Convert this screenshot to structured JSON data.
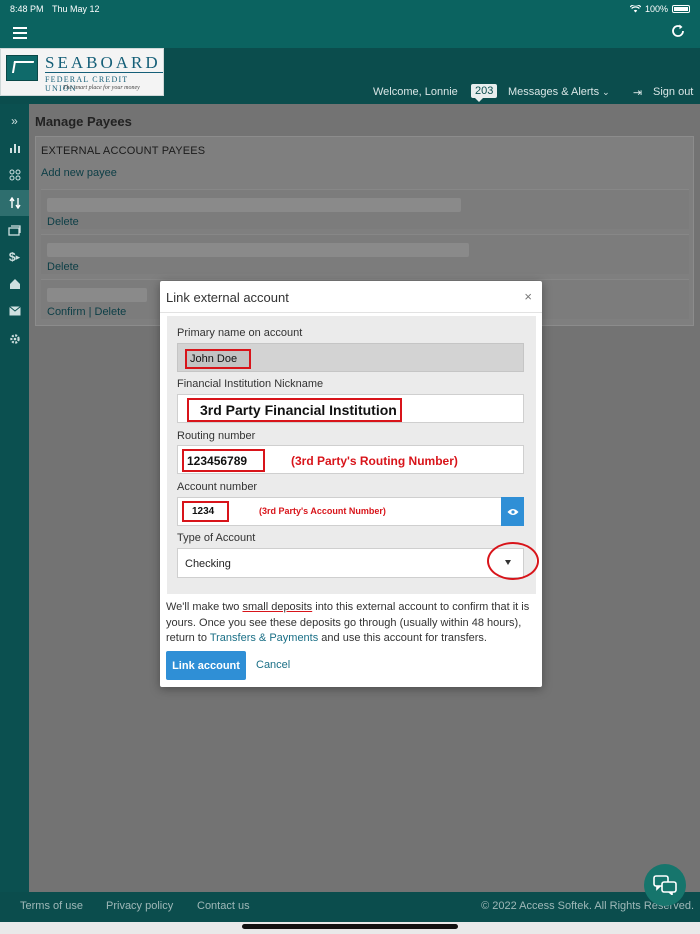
{
  "status_bar": {
    "time": "8:48 PM",
    "date": "Thu May 12",
    "battery": "100%"
  },
  "header": {
    "logo": {
      "name": "SEABOARD",
      "subtitle": "FEDERAL CREDIT UNION",
      "tagline": "The smart place for your money"
    },
    "welcome": "Welcome, Lonnie",
    "messages_count": "203",
    "messages_label": "Messages & Alerts",
    "signout_label": "Sign out"
  },
  "sidebar": {
    "items": [
      {
        "icon": "expand-chevrons-icon"
      },
      {
        "icon": "bar-chart-icon"
      },
      {
        "icon": "apps-icon"
      },
      {
        "icon": "transfer-arrows-icon",
        "active": true
      },
      {
        "icon": "bill-pay-icon"
      },
      {
        "icon": "dollar-icon"
      },
      {
        "icon": "home-icon"
      },
      {
        "icon": "mail-icon"
      },
      {
        "icon": "gear-icon"
      }
    ]
  },
  "main": {
    "page_title": "Manage Payees",
    "panel_heading": "EXTERNAL ACCOUNT PAYEES",
    "add_payee_label": "Add new payee",
    "rows": [
      {
        "delete_label": "Delete"
      },
      {
        "delete_label": "Delete"
      },
      {
        "confirm_label": "Confirm",
        "separator": "|",
        "delete_label": "Delete"
      }
    ]
  },
  "modal": {
    "title": "Link external account",
    "close_label": "×",
    "fields": {
      "primary_name": {
        "label": "Primary name on account",
        "value": "John Doe"
      },
      "nickname": {
        "label": "Financial Institution Nickname",
        "value": "3rd Party Financial Institution"
      },
      "routing": {
        "label": "Routing number",
        "value": "123456789",
        "note": "(3rd Party's Routing Number)"
      },
      "account": {
        "label": "Account number",
        "value": "1234",
        "note": "(3rd Party's Account Number)"
      },
      "account_type": {
        "label": "Type of Account",
        "value": "Checking"
      }
    },
    "info": {
      "part1": "We'll make two ",
      "small_deposits": "small deposits",
      "part2": " into this external account to confirm that it is yours. Once you see these deposits go through (usually within 48 hours), return to ",
      "link": "Transfers & Payments",
      "part3": " and use this account for transfers."
    },
    "link_button_label": "Link account",
    "cancel_label": "Cancel"
  },
  "footer": {
    "terms": "Terms of use",
    "privacy": "Privacy policy",
    "contact": "Contact us",
    "copyright": "© 2022 Access Softek. All Rights Reserved."
  },
  "colors": {
    "brand_teal": "#0b5a5a",
    "button_blue": "#2f8fd6",
    "annotation_red": "#d8141a",
    "link_teal": "#1a6f86"
  }
}
